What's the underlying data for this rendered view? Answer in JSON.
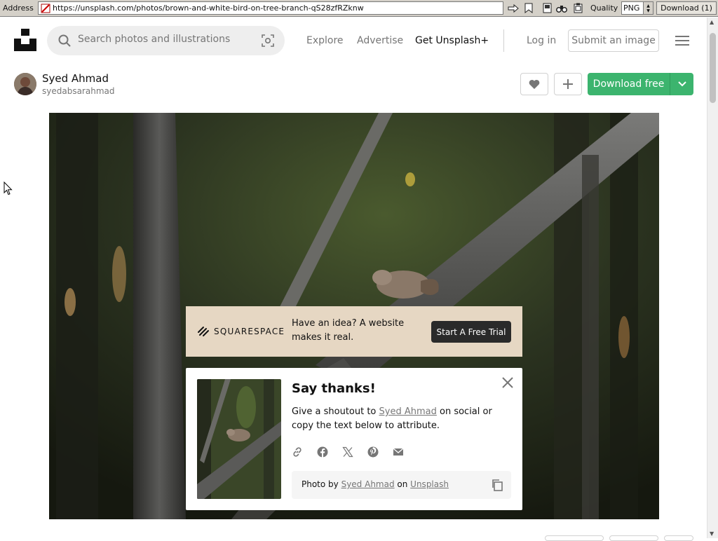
{
  "browser": {
    "address_label": "Address",
    "url": "https://unsplash.com/photos/brown-and-white-bird-on-tree-branch-qS28zfRZknw",
    "quality_label": "Quality",
    "quality_value": "PNG",
    "download_label": "Download (1)"
  },
  "header": {
    "search_placeholder": "Search photos and illustrations",
    "nav": [
      "Explore",
      "Advertise",
      "Get Unsplash+"
    ],
    "login": "Log in",
    "submit": "Submit an image"
  },
  "author": {
    "name": "Syed Ahmad",
    "handle": "syedabsarahmad"
  },
  "actions": {
    "download": "Download free"
  },
  "ad": {
    "brand": "SQUARESPACE",
    "text": "Have an idea? A website makes it real.",
    "cta": "Start A Free Trial"
  },
  "thanks": {
    "title": "Say thanks!",
    "body_prefix": "Give a shoutout to ",
    "body_link": "Syed Ahmad",
    "body_suffix": " on social or copy the text below to attribute.",
    "attr_prefix": "Photo by ",
    "attr_author": "Syed Ahmad",
    "attr_mid": " on ",
    "attr_site": "Unsplash"
  },
  "colors": {
    "accent_green": "#3cb46e",
    "ad_bg": "#e6d7c3"
  }
}
